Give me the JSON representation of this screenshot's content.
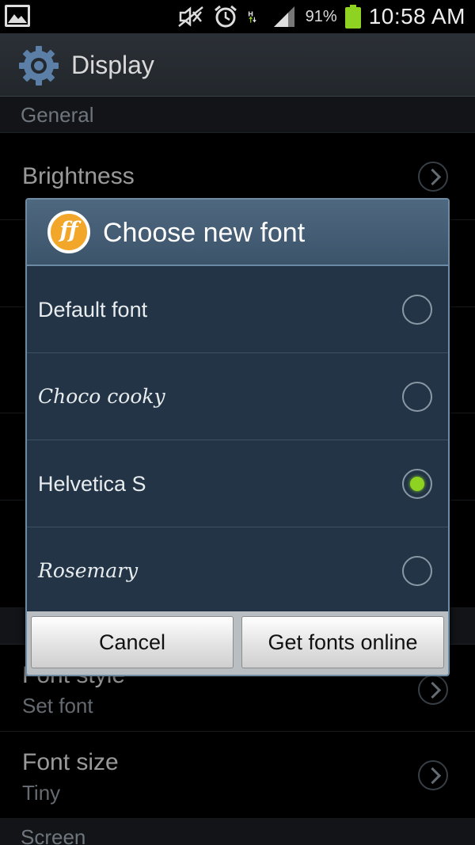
{
  "status_bar": {
    "battery_percent": "91%",
    "time": "10:58 AM",
    "network_type": "H",
    "icons": [
      "image-icon",
      "mute-icon",
      "alarm-icon",
      "network-h-icon",
      "signal-icon",
      "battery-icon"
    ]
  },
  "action_bar": {
    "title": "Display",
    "icon": "gear-icon"
  },
  "settings": {
    "section_general": "General",
    "brightness": {
      "title": "Brightness"
    },
    "font_style": {
      "title": "Font style",
      "subtitle": "Set font"
    },
    "font_size": {
      "title": "Font size",
      "subtitle": "Tiny"
    },
    "section_screen": "Screen"
  },
  "dialog": {
    "title": "Choose new font",
    "logo_text": "ff",
    "options": [
      {
        "label": "Default font",
        "selected": false
      },
      {
        "label": "Choco cooky",
        "selected": false
      },
      {
        "label": "Helvetica S",
        "selected": true
      },
      {
        "label": "Rosemary",
        "selected": false
      }
    ],
    "buttons": {
      "cancel": "Cancel",
      "get_fonts": "Get fonts online"
    }
  },
  "colors": {
    "accent_radio": "#8ed322",
    "dialog_bg": "#223445",
    "title_bar": "#4e6880"
  }
}
